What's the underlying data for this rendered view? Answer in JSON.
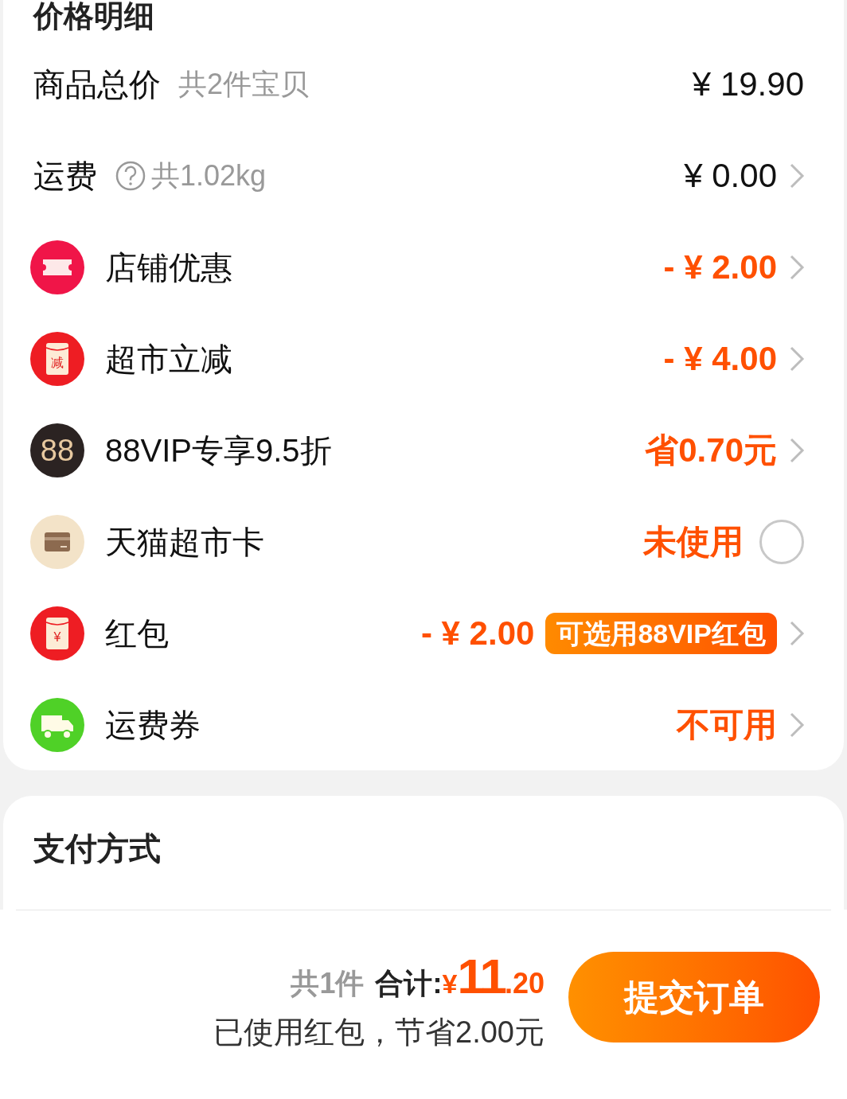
{
  "price_card": {
    "title": "价格明细",
    "rows": [
      {
        "kind": "plain",
        "label": "商品总价",
        "note": "共2件宝贝",
        "help": false,
        "value": "¥ 19.90",
        "chevron": false
      },
      {
        "kind": "plain",
        "label": "运费",
        "note": "共1.02kg",
        "help": true,
        "value": "¥ 0.00",
        "chevron": true
      },
      {
        "kind": "ticket",
        "label": "店铺优惠",
        "value": "- ¥ 2.00",
        "chevron": true
      },
      {
        "kind": "envelope",
        "glyph": "减",
        "label": "超市立减",
        "value": "- ¥ 4.00",
        "chevron": true
      },
      {
        "kind": "vip",
        "glyph": "88",
        "label": "88VIP专享9.5折",
        "value": "省0.70元",
        "chevron": true
      },
      {
        "kind": "card",
        "label": "天猫超市卡",
        "value": "未使用",
        "checked": false
      },
      {
        "kind": "envelope",
        "glyph": "¥",
        "label": "红包",
        "value": "- ¥ 2.00",
        "badge": "可选用88VIP红包",
        "chevron": true
      },
      {
        "kind": "truck",
        "label": "运费券",
        "value": "不可用",
        "chevron": true
      }
    ]
  },
  "payment_card": {
    "title": "支付方式"
  },
  "bottom_bar": {
    "count": "共1件",
    "total_label": "合计:",
    "currency": "¥",
    "total_int": "11",
    "total_dec": ".20",
    "saving": "已使用红包，节省2.00元",
    "submit": "提交订单"
  }
}
